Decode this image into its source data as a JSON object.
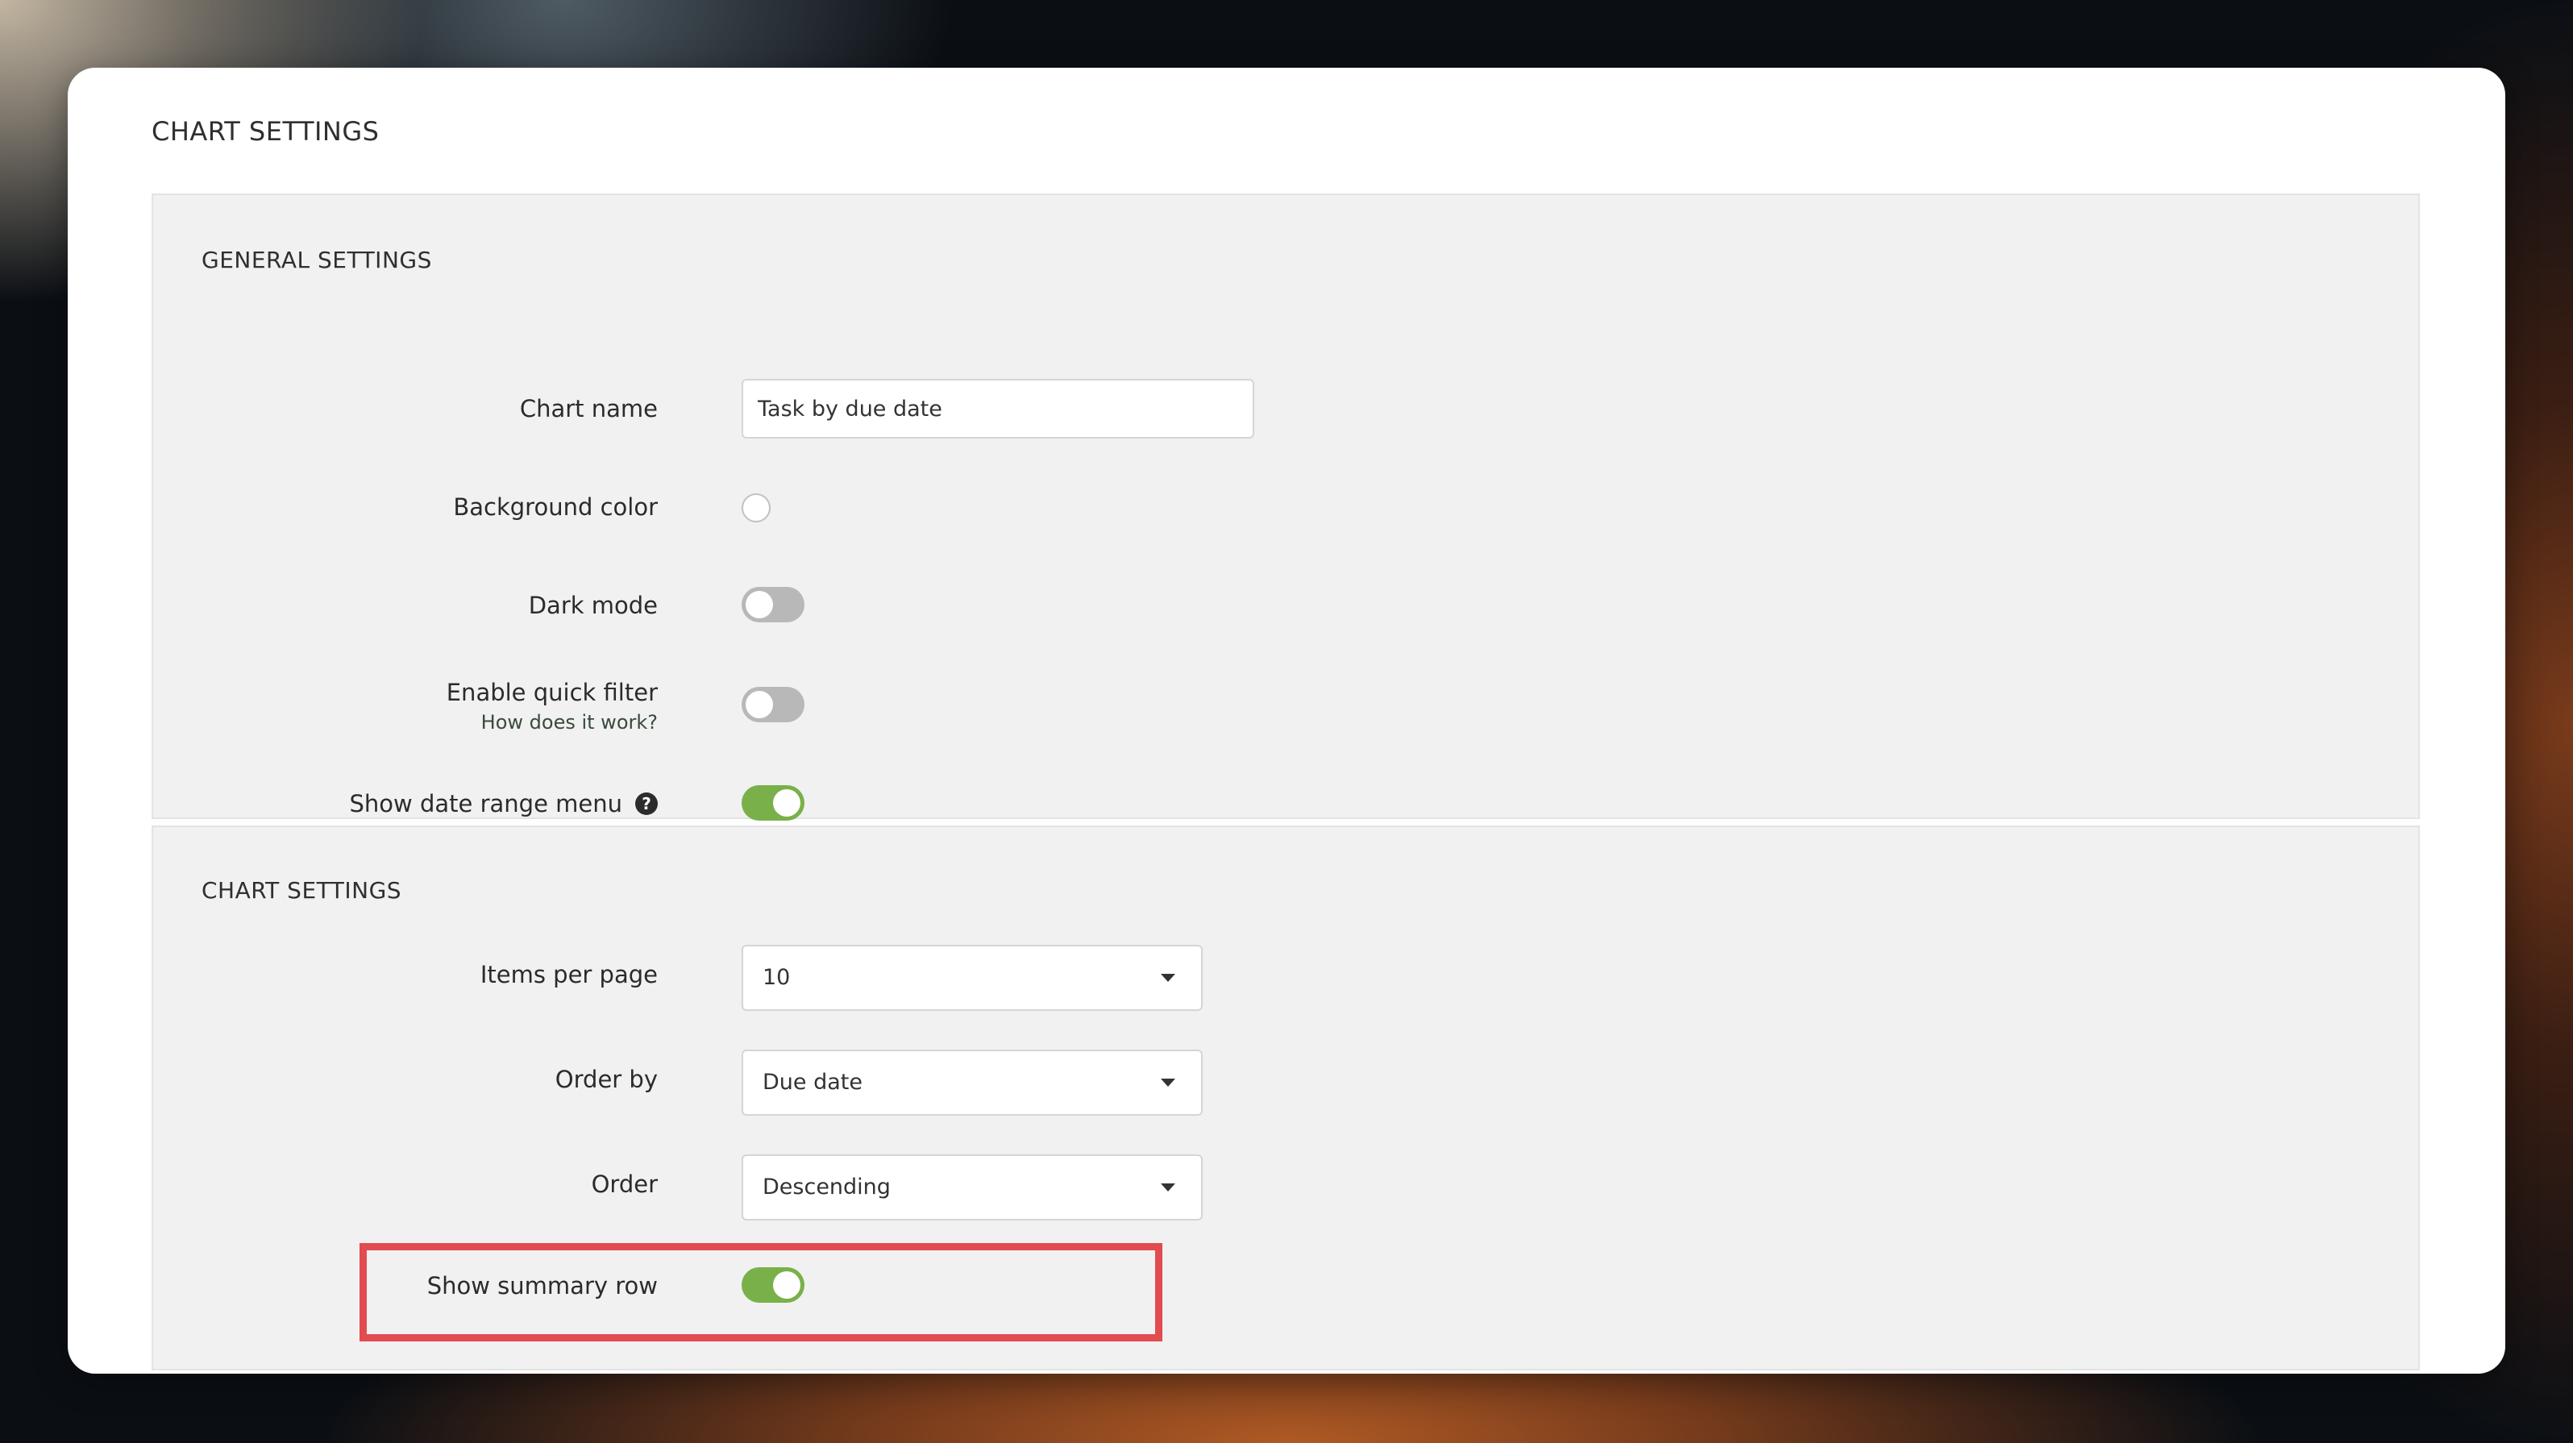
{
  "page": {
    "title": "CHART SETTINGS"
  },
  "general": {
    "title": "GENERAL SETTINGS",
    "chart_name_label": "Chart name",
    "chart_name_value": "Task by due date",
    "background_color_label": "Background color",
    "background_color_value": "#ffffff",
    "dark_mode_label": "Dark mode",
    "dark_mode_on": false,
    "quick_filter_label": "Enable quick filter",
    "quick_filter_help_link": "How does it work?",
    "quick_filter_on": false,
    "date_range_label": "Show date range menu",
    "date_range_help_glyph": "?",
    "date_range_on": true
  },
  "chart": {
    "title": "CHART SETTINGS",
    "items_per_page_label": "Items per page",
    "items_per_page_value": "10",
    "order_by_label": "Order by",
    "order_by_value": "Due date",
    "order_label": "Order",
    "order_value": "Descending",
    "summary_row_label": "Show summary row",
    "summary_row_on": true
  },
  "colors": {
    "toggle_on": "#7ab04a",
    "toggle_off": "#b8b8b8",
    "highlight": "#e24b4f",
    "panel_bg": "#f0f1f0"
  },
  "icons": {
    "help": "help-icon",
    "dropdown": "caret-down-icon"
  }
}
